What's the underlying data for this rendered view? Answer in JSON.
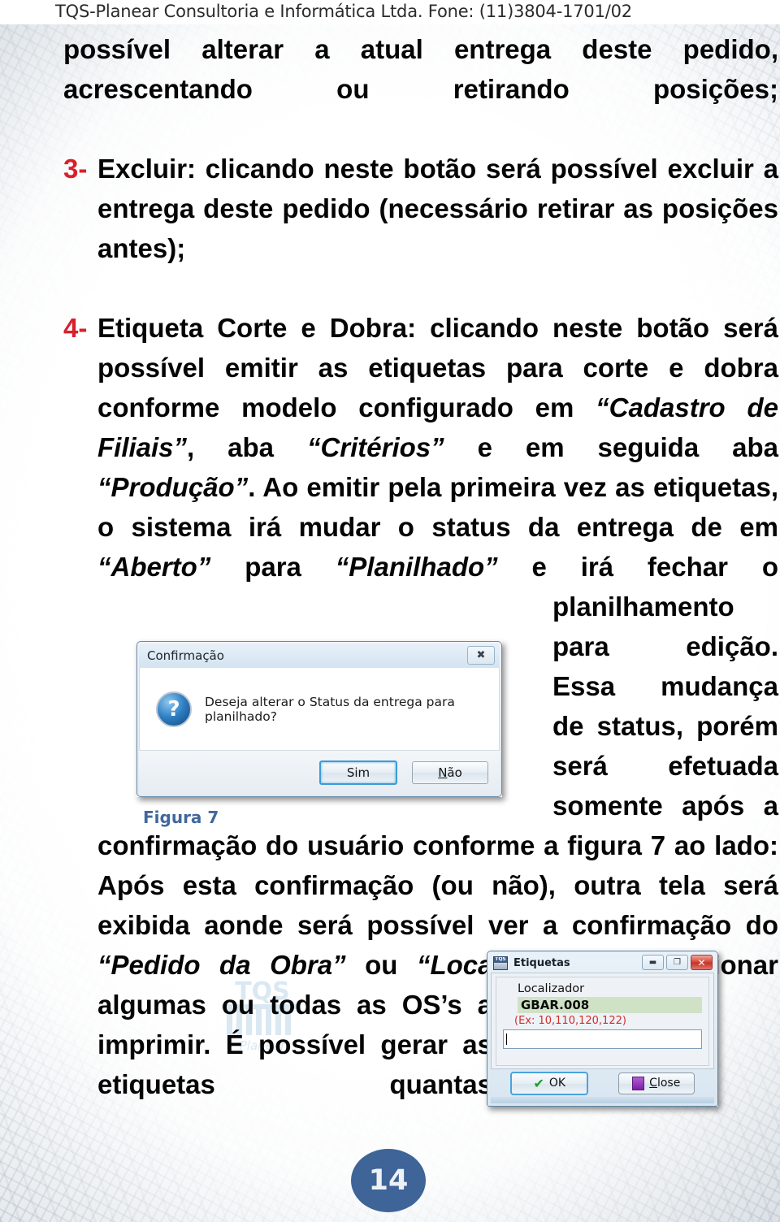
{
  "header": {
    "company_line": "TQS-Planear Consultoria e Informática Ltda. Fone: (11)3804-1701/02"
  },
  "content": {
    "para_continuation": "possível alterar a atual entrega deste pedido, acrescentando ou retirando posições;",
    "item3": {
      "marker": "3-",
      "term": "Excluir:",
      "text": " clicando neste botão será possível excluir a entrega deste pedido (necessário retirar as posições antes);"
    },
    "item4": {
      "marker": "4-",
      "term": "Etiqueta Corte e Dobra:",
      "text_a": " clicando neste botão será possível emitir as etiquetas para corte e dobra conforme modelo configurado em ",
      "quote_cadastro": "“Cadastro de Filiais”",
      "text_b": ", aba ",
      "quote_criterios": "“Critérios”",
      "text_c": " e em seguida aba ",
      "quote_producao": "“Produção”",
      "text_d": ". Ao emitir pela primeira vez as etiquetas, o sistema irá mudar o status da entrega de em ",
      "quote_aberto": "“Aberto”",
      "text_e": " para ",
      "quote_planilhado": "“Planilhado”",
      "text_f": " e irá fechar o planilhamento para edição. Essa mudança de status, porém será efetuada somente após a confirmação do usuário conforme a figura 7 ao lado: Após esta confirmação (ou não), outra tela será exibida aonde será possível ver a confirmação do ",
      "quote_pedido": "“Pedido da Obra”",
      "text_g": " ou ",
      "quote_localizador": "“Localizador”",
      "text_h": " e selecionar algumas ou todas as OS’s a imprimir. É possível gerar as etiquetas quantas"
    }
  },
  "figure7": {
    "caption": "Figura 7",
    "dialog": {
      "title": "Confirmação",
      "close_glyph": "✖",
      "icon": "question-icon",
      "message": "Deseja alterar o Status da entrega para planilhado?",
      "button_yes": "Sim",
      "button_no_prefix": "N",
      "button_no_suffix": "ão"
    }
  },
  "etiquetas_window": {
    "title": "Etiquetas",
    "app_icon": "tqs-icon",
    "minimize_glyph": "▬",
    "maximize_glyph": "❐",
    "close_glyph": "✕",
    "field_label": "Localizador",
    "field_value": "GBAR.008",
    "field_example": "(Ex: 10,110,120,122)",
    "input_value": "",
    "button_ok": "OK",
    "button_close_prefix": "C",
    "button_close_suffix": "lose"
  },
  "page_number": "14",
  "watermark": {
    "text": "TQS"
  },
  "colors": {
    "marker_red": "#d8202b",
    "caption_blue": "#41689b",
    "page_badge_blue": "#3e6498",
    "field_green": "#cfe2c6",
    "example_red": "#d42b2b"
  }
}
